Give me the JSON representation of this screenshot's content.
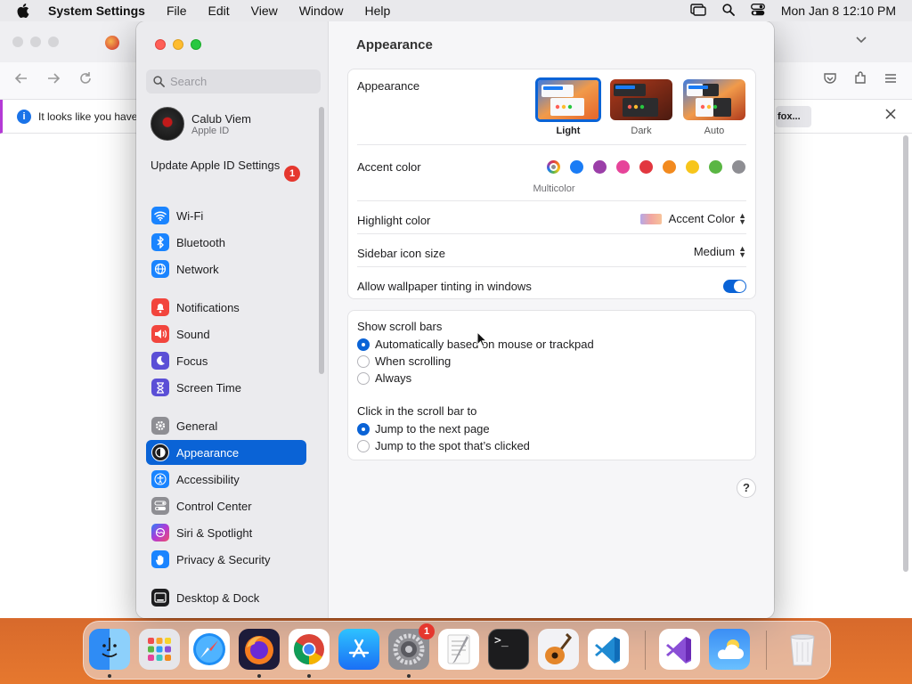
{
  "menubar": {
    "app_name": "System Settings",
    "items": [
      "File",
      "Edit",
      "View",
      "Window",
      "Help"
    ],
    "datetime": "Mon Jan 8  12:10 PM"
  },
  "browser": {
    "notice_text": "It looks like you haven",
    "notice_button": "fox..."
  },
  "sidebar": {
    "search_placeholder": "Search",
    "account": {
      "name": "Calub Viem",
      "subtitle": "Apple ID"
    },
    "update": {
      "label": "Update Apple ID Settings",
      "badge": "1"
    },
    "items": [
      {
        "label": "Wi-Fi",
        "icon": "wifi-icon",
        "color": "#1a84ff"
      },
      {
        "label": "Bluetooth",
        "icon": "bluetooth-icon",
        "color": "#1a84ff"
      },
      {
        "label": "Network",
        "icon": "globe-icon",
        "color": "#1a84ff"
      },
      {
        "label": "Notifications",
        "icon": "bell-icon",
        "color": "#f2453d"
      },
      {
        "label": "Sound",
        "icon": "speaker-icon",
        "color": "#f2453d"
      },
      {
        "label": "Focus",
        "icon": "moon-icon",
        "color": "#5b4fd6"
      },
      {
        "label": "Screen Time",
        "icon": "hourglass-icon",
        "color": "#5b4fd6"
      },
      {
        "label": "General",
        "icon": "gear-icon",
        "color": "#8e8e93"
      },
      {
        "label": "Appearance",
        "icon": "appearance-icon",
        "color": "#1d1d1f"
      },
      {
        "label": "Accessibility",
        "icon": "accessibility-icon",
        "color": "#1a84ff"
      },
      {
        "label": "Control Center",
        "icon": "switches-icon",
        "color": "#8e8e93"
      },
      {
        "label": "Siri & Spotlight",
        "icon": "siri-icon",
        "color": "#6a3ad6"
      },
      {
        "label": "Privacy & Security",
        "icon": "hand-icon",
        "color": "#1a84ff"
      },
      {
        "label": "Desktop & Dock",
        "icon": "dock-icon",
        "color": "#1d1d1f"
      }
    ]
  },
  "main": {
    "title": "Appearance",
    "appearance": {
      "label": "Appearance",
      "options": [
        "Light",
        "Dark",
        "Auto"
      ],
      "selected": "Light"
    },
    "accent": {
      "label": "Accent color",
      "selected_name": "Multicolor",
      "colors": [
        "#1a7cf5",
        "#9b3fa8",
        "#e6449a",
        "#e2373f",
        "#f28a1f",
        "#f7c51b",
        "#5ab643",
        "#8e8e93"
      ]
    },
    "highlight": {
      "label": "Highlight color",
      "value": "Accent Color"
    },
    "icon_size": {
      "label": "Sidebar icon size",
      "value": "Medium"
    },
    "tinting": {
      "label": "Allow wallpaper tinting in windows",
      "on": true
    },
    "scroll_bars": {
      "label": "Show scroll bars",
      "options": [
        "Automatically based on mouse or trackpad",
        "When scrolling",
        "Always"
      ],
      "selected": 0
    },
    "click_scroll": {
      "label": "Click in the scroll bar to",
      "options": [
        "Jump to the next page",
        "Jump to the spot that’s clicked"
      ],
      "selected": 0
    },
    "help": "?"
  },
  "dock": {
    "apps": [
      "finder-icon",
      "launchpad-icon",
      "safari-icon",
      "firefox-icon",
      "chrome-icon",
      "app-store-icon",
      "system-settings-icon",
      "textedit-icon",
      "terminal-icon",
      "garageband-icon",
      "vscode-icon",
      "visual-studio-icon",
      "weather-icon",
      "trash-icon"
    ],
    "settings_badge": "1",
    "terminal_text": ">_"
  }
}
